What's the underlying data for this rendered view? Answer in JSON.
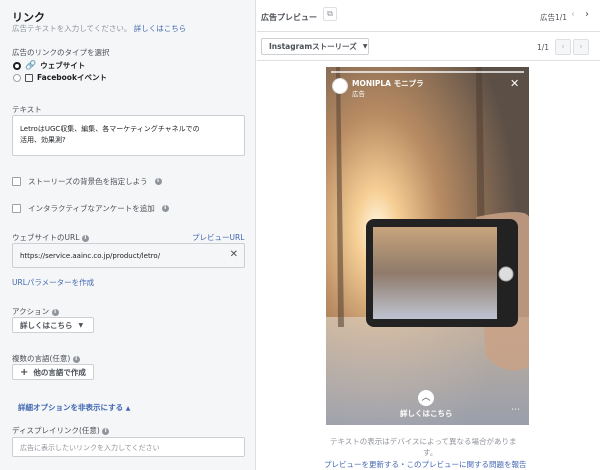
{
  "left": {
    "title": "リンク",
    "subtitle": "広告テキストを入力してください。",
    "learn_more": "詳しくはこちら",
    "link_type_label": "広告のリンクのタイプを選択",
    "options": [
      "ウェブサイト",
      "Facebookイベント"
    ],
    "text_label": "テキスト",
    "text_value_line1": "LetroはUGC収集、編集、各マーケティングチャネルでの",
    "text_value_line2": "活用、効果測?",
    "story_bg_label": "ストーリーズの背景色を指定しよう",
    "poll_label": "インタラクティブなアンケートを追加",
    "url_label": "ウェブサイトのURL",
    "preview_url": "プレビューURL",
    "url_value": "https://service.aainc.co.jp/product/letro/",
    "url_params": "URLパラメーターを作成",
    "action_label": "アクション",
    "action_value": "詳しくはこちら",
    "multi_lang_label": "複数の言語(任意)",
    "multi_lang_button": "他の言語で作成",
    "advanced_toggle": "詳細オプションを非表示にする",
    "display_link_label": "ディスプレイリンク(任意)",
    "display_link_placeholder": "広告に表示したいリンクを入力してください"
  },
  "preview": {
    "title": "広告プレビュー",
    "page_count": "広告1/1",
    "placement": "Instagramストーリーズ",
    "placement_count": "1/1",
    "account_name": "MONIPLA モニプラ",
    "sponsored": "広告",
    "cta": "詳しくはこちら",
    "disclaimer": "テキストの表示はデバイスによって異なる場合がありま",
    "disclaimer2": "す。",
    "footer_links": "プレビューを更新する・このプレビューに関する問題を報告"
  },
  "colors": {
    "accent": "#4267b2",
    "panel_bg": "#f5f6f7",
    "border": "#ccd0d5"
  }
}
